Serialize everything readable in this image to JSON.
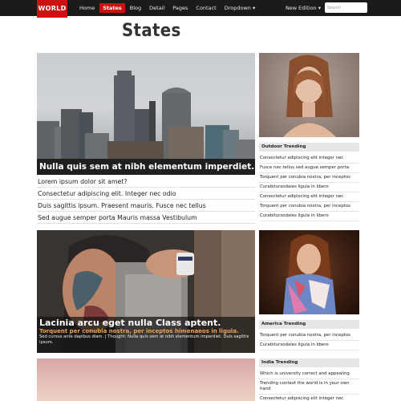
{
  "nav": {
    "logo": "WORLD",
    "items": [
      "Home",
      "States",
      "Blog",
      "Detail",
      "Pages",
      "Contact",
      "Dropdown ▾"
    ],
    "edition": "New Edition ▾",
    "search_placeholder": "Search"
  },
  "page_title": "States",
  "feature1": {
    "caption": "Nulla quis sem at nibh elementum imperdiet."
  },
  "list": [
    "Lorem ipsum dolor sit amet?",
    "Consectetur adipiscing elit. Integer nec odio",
    "Duis sagittis ipsum. Praesent mauris. Fusce nec tellus",
    "Sed augue semper porta Mauris massa Vestibulum"
  ],
  "feature2": {
    "title": "Lacinia arcu eget nulla Class aptent.",
    "subtitle": "Torquent per conubia nostra, per inceptos himenaeos in ligula.",
    "body": "Sed cursus ante dapibus diam. | Thought: Nulla quis sem at nibh elementum imperdiet. Duis sagittis ipsum."
  },
  "sidebar": {
    "outdoor": {
      "heading": "Outdoor Trending",
      "items": [
        "Consectetur adipiscing elit integer nec",
        "Fusce nec tellus sed augue semper porta.",
        "Torquent per conubia nostra, per inceptos",
        "Curabitursodales ligula in libero",
        "Consectetur adipiscing elit integer nec",
        "Torquent per conubia nostra, per inceptos",
        "Curabitursodales ligula in libero"
      ]
    },
    "america": {
      "heading": "America Trending",
      "items": [
        "Torquent per conubia nostra, per inceptos",
        "Curabitursodales ligula in libero"
      ]
    },
    "india": {
      "heading": "India Trending",
      "items": [
        "Which is university correct and appealing",
        "Trending context the world is in your own hand",
        "Consectetur adipiscing elit integer nec"
      ]
    }
  },
  "colors": {
    "accent": "#cc1111",
    "nav_bg": "#1b1b1b",
    "caption_sub": "#f0a050"
  }
}
